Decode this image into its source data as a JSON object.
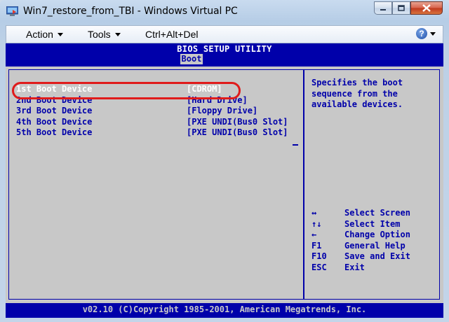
{
  "window": {
    "title": "Win7_restore_from_TBI - Windows Virtual PC"
  },
  "menubar": {
    "items": [
      {
        "label": "Action"
      },
      {
        "label": "Tools"
      },
      {
        "label": "Ctrl+Alt+Del"
      }
    ]
  },
  "bios": {
    "title": "BIOS SETUP UTILITY",
    "active_tab": "Boot",
    "boot_devices": [
      {
        "label": "1st Boot Device",
        "value": "[CDROM]",
        "selected": true
      },
      {
        "label": "2nd Boot Device",
        "value": "[Hard Drive]"
      },
      {
        "label": "3rd Boot Device",
        "value": "[Floppy Drive]"
      },
      {
        "label": "4th Boot Device",
        "value": "[PXE UNDI(Bus0 Slot]"
      },
      {
        "label": "5th Boot Device",
        "value": "[PXE UNDI(Bus0 Slot]"
      }
    ],
    "help_lines": [
      "Specifies the boot",
      "sequence from the",
      "available devices."
    ],
    "keys": [
      {
        "key": "↔",
        "desc": "Select Screen"
      },
      {
        "key": "↑↓",
        "desc": "Select Item"
      },
      {
        "key": "←",
        "desc": "Change Option"
      },
      {
        "key": "F1",
        "desc": "General Help"
      },
      {
        "key": "F10",
        "desc": "Save and Exit"
      },
      {
        "key": "ESC",
        "desc": "Exit"
      }
    ],
    "footer": "v02.10 (C)Copyright 1985-2001, American Megatrends, Inc."
  },
  "colors": {
    "bios_blue": "#0000aa",
    "bios_gray": "#c8c8c8",
    "highlight": "#e01b1b"
  }
}
